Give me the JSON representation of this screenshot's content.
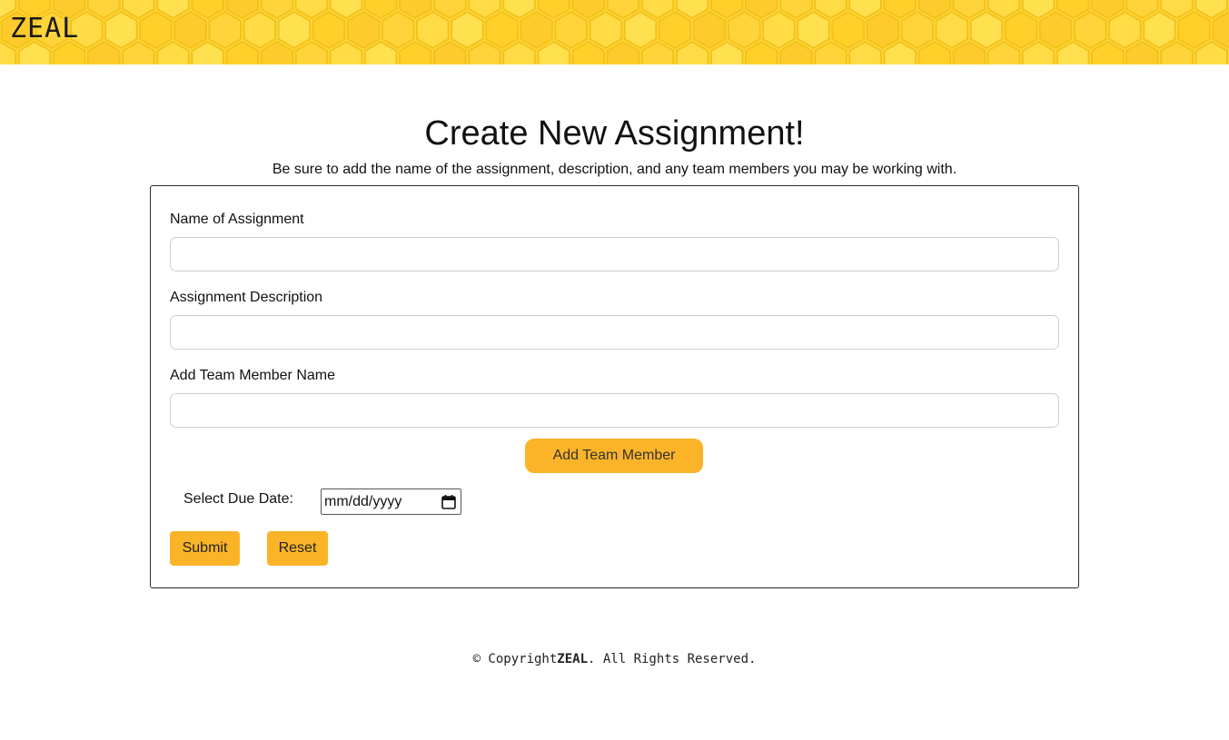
{
  "header": {
    "logo": "ZEAL",
    "background_color": "#ffd83a"
  },
  "page": {
    "title": "Create New Assignment!",
    "subtitle": "Be sure to add the name of the assignment, description, and any team members you may be working with."
  },
  "form": {
    "name_label": "Name of Assignment",
    "name_value": "",
    "description_label": "Assignment Description",
    "description_value": "",
    "member_label": "Add Team Member Name",
    "member_value": "",
    "add_member_button": "Add Team Member",
    "due_label": "Select Due Date:",
    "due_placeholder": "mm/dd/yyyy",
    "submit_button": "Submit",
    "reset_button": "Reset",
    "accent_color": "#fbb428"
  },
  "footer": {
    "prefix": "© Copyright",
    "brand": "ZEAL",
    "suffix": ". All Rights Reserved."
  }
}
